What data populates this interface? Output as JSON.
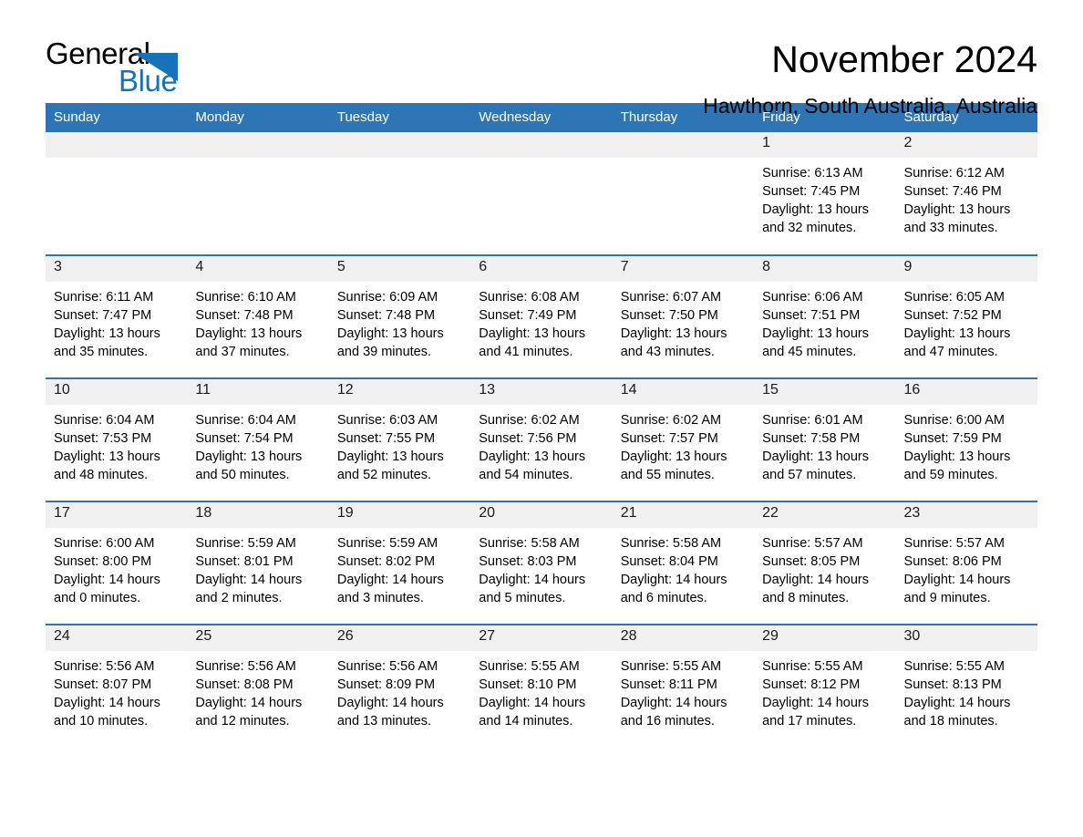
{
  "brand": {
    "name_part1": "General",
    "name_part2": "Blue",
    "triangle_color": "#1573ba",
    "accent_color": "#2e75b6"
  },
  "header": {
    "title": "November 2024",
    "subtitle": "Hawthorn, South Australia, Australia"
  },
  "weekdays": [
    "Sunday",
    "Monday",
    "Tuesday",
    "Wednesday",
    "Thursday",
    "Friday",
    "Saturday"
  ],
  "weeks": [
    [
      {
        "day": "",
        "sunrise": "",
        "sunset": "",
        "daylight": ""
      },
      {
        "day": "",
        "sunrise": "",
        "sunset": "",
        "daylight": ""
      },
      {
        "day": "",
        "sunrise": "",
        "sunset": "",
        "daylight": ""
      },
      {
        "day": "",
        "sunrise": "",
        "sunset": "",
        "daylight": ""
      },
      {
        "day": "",
        "sunrise": "",
        "sunset": "",
        "daylight": ""
      },
      {
        "day": "1",
        "sunrise": "Sunrise: 6:13 AM",
        "sunset": "Sunset: 7:45 PM",
        "daylight": "Daylight: 13 hours and 32 minutes."
      },
      {
        "day": "2",
        "sunrise": "Sunrise: 6:12 AM",
        "sunset": "Sunset: 7:46 PM",
        "daylight": "Daylight: 13 hours and 33 minutes."
      }
    ],
    [
      {
        "day": "3",
        "sunrise": "Sunrise: 6:11 AM",
        "sunset": "Sunset: 7:47 PM",
        "daylight": "Daylight: 13 hours and 35 minutes."
      },
      {
        "day": "4",
        "sunrise": "Sunrise: 6:10 AM",
        "sunset": "Sunset: 7:48 PM",
        "daylight": "Daylight: 13 hours and 37 minutes."
      },
      {
        "day": "5",
        "sunrise": "Sunrise: 6:09 AM",
        "sunset": "Sunset: 7:48 PM",
        "daylight": "Daylight: 13 hours and 39 minutes."
      },
      {
        "day": "6",
        "sunrise": "Sunrise: 6:08 AM",
        "sunset": "Sunset: 7:49 PM",
        "daylight": "Daylight: 13 hours and 41 minutes."
      },
      {
        "day": "7",
        "sunrise": "Sunrise: 6:07 AM",
        "sunset": "Sunset: 7:50 PM",
        "daylight": "Daylight: 13 hours and 43 minutes."
      },
      {
        "day": "8",
        "sunrise": "Sunrise: 6:06 AM",
        "sunset": "Sunset: 7:51 PM",
        "daylight": "Daylight: 13 hours and 45 minutes."
      },
      {
        "day": "9",
        "sunrise": "Sunrise: 6:05 AM",
        "sunset": "Sunset: 7:52 PM",
        "daylight": "Daylight: 13 hours and 47 minutes."
      }
    ],
    [
      {
        "day": "10",
        "sunrise": "Sunrise: 6:04 AM",
        "sunset": "Sunset: 7:53 PM",
        "daylight": "Daylight: 13 hours and 48 minutes."
      },
      {
        "day": "11",
        "sunrise": "Sunrise: 6:04 AM",
        "sunset": "Sunset: 7:54 PM",
        "daylight": "Daylight: 13 hours and 50 minutes."
      },
      {
        "day": "12",
        "sunrise": "Sunrise: 6:03 AM",
        "sunset": "Sunset: 7:55 PM",
        "daylight": "Daylight: 13 hours and 52 minutes."
      },
      {
        "day": "13",
        "sunrise": "Sunrise: 6:02 AM",
        "sunset": "Sunset: 7:56 PM",
        "daylight": "Daylight: 13 hours and 54 minutes."
      },
      {
        "day": "14",
        "sunrise": "Sunrise: 6:02 AM",
        "sunset": "Sunset: 7:57 PM",
        "daylight": "Daylight: 13 hours and 55 minutes."
      },
      {
        "day": "15",
        "sunrise": "Sunrise: 6:01 AM",
        "sunset": "Sunset: 7:58 PM",
        "daylight": "Daylight: 13 hours and 57 minutes."
      },
      {
        "day": "16",
        "sunrise": "Sunrise: 6:00 AM",
        "sunset": "Sunset: 7:59 PM",
        "daylight": "Daylight: 13 hours and 59 minutes."
      }
    ],
    [
      {
        "day": "17",
        "sunrise": "Sunrise: 6:00 AM",
        "sunset": "Sunset: 8:00 PM",
        "daylight": "Daylight: 14 hours and 0 minutes."
      },
      {
        "day": "18",
        "sunrise": "Sunrise: 5:59 AM",
        "sunset": "Sunset: 8:01 PM",
        "daylight": "Daylight: 14 hours and 2 minutes."
      },
      {
        "day": "19",
        "sunrise": "Sunrise: 5:59 AM",
        "sunset": "Sunset: 8:02 PM",
        "daylight": "Daylight: 14 hours and 3 minutes."
      },
      {
        "day": "20",
        "sunrise": "Sunrise: 5:58 AM",
        "sunset": "Sunset: 8:03 PM",
        "daylight": "Daylight: 14 hours and 5 minutes."
      },
      {
        "day": "21",
        "sunrise": "Sunrise: 5:58 AM",
        "sunset": "Sunset: 8:04 PM",
        "daylight": "Daylight: 14 hours and 6 minutes."
      },
      {
        "day": "22",
        "sunrise": "Sunrise: 5:57 AM",
        "sunset": "Sunset: 8:05 PM",
        "daylight": "Daylight: 14 hours and 8 minutes."
      },
      {
        "day": "23",
        "sunrise": "Sunrise: 5:57 AM",
        "sunset": "Sunset: 8:06 PM",
        "daylight": "Daylight: 14 hours and 9 minutes."
      }
    ],
    [
      {
        "day": "24",
        "sunrise": "Sunrise: 5:56 AM",
        "sunset": "Sunset: 8:07 PM",
        "daylight": "Daylight: 14 hours and 10 minutes."
      },
      {
        "day": "25",
        "sunrise": "Sunrise: 5:56 AM",
        "sunset": "Sunset: 8:08 PM",
        "daylight": "Daylight: 14 hours and 12 minutes."
      },
      {
        "day": "26",
        "sunrise": "Sunrise: 5:56 AM",
        "sunset": "Sunset: 8:09 PM",
        "daylight": "Daylight: 14 hours and 13 minutes."
      },
      {
        "day": "27",
        "sunrise": "Sunrise: 5:55 AM",
        "sunset": "Sunset: 8:10 PM",
        "daylight": "Daylight: 14 hours and 14 minutes."
      },
      {
        "day": "28",
        "sunrise": "Sunrise: 5:55 AM",
        "sunset": "Sunset: 8:11 PM",
        "daylight": "Daylight: 14 hours and 16 minutes."
      },
      {
        "day": "29",
        "sunrise": "Sunrise: 5:55 AM",
        "sunset": "Sunset: 8:12 PM",
        "daylight": "Daylight: 14 hours and 17 minutes."
      },
      {
        "day": "30",
        "sunrise": "Sunrise: 5:55 AM",
        "sunset": "Sunset: 8:13 PM",
        "daylight": "Daylight: 14 hours and 18 minutes."
      }
    ]
  ]
}
